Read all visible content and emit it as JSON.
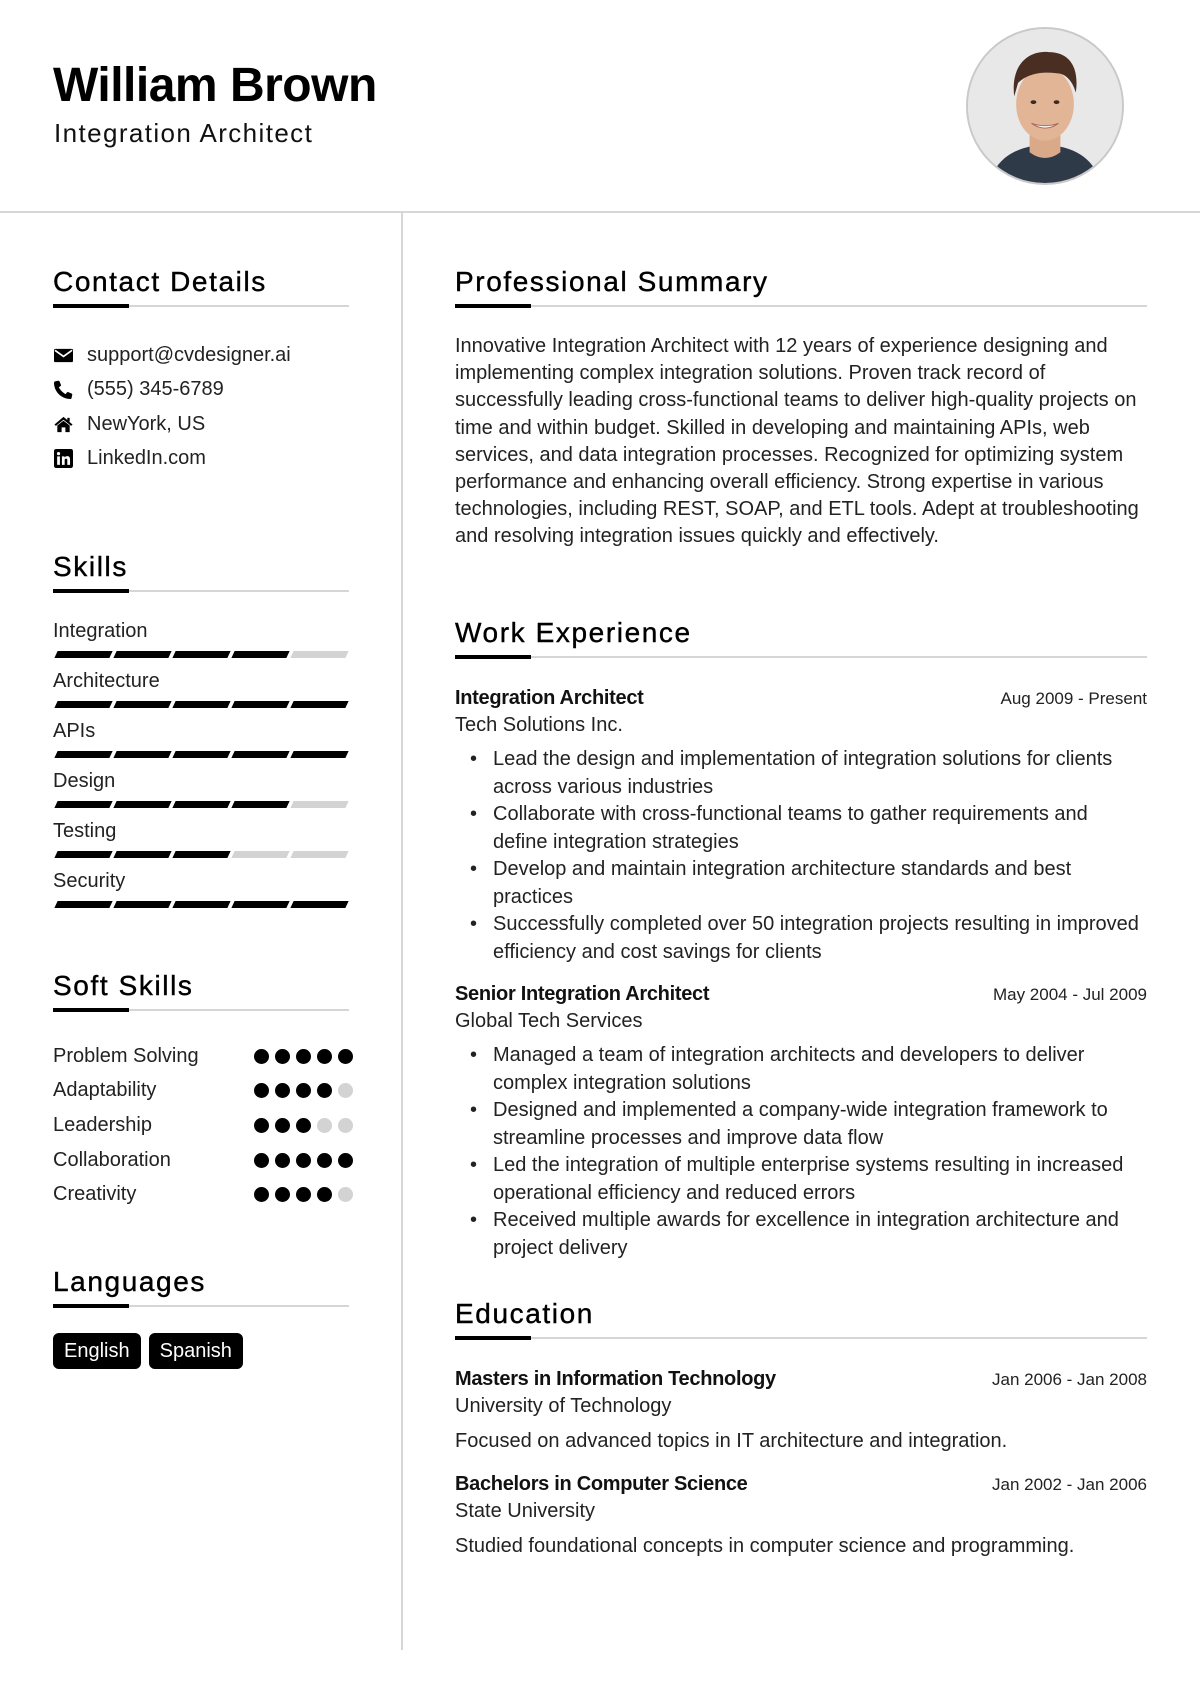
{
  "header": {
    "name": "William Brown",
    "title": "Integration Architect",
    "photo_alt": "profile-photo"
  },
  "contact": {
    "heading": "Contact Details",
    "items": [
      {
        "icon": "envelope-icon",
        "text": "support@cvdesigner.ai"
      },
      {
        "icon": "phone-icon",
        "text": "(555) 345-6789"
      },
      {
        "icon": "home-icon",
        "text": "NewYork, US"
      },
      {
        "icon": "linkedin-icon",
        "text": "LinkedIn.com"
      }
    ]
  },
  "skills": {
    "heading": "Skills",
    "max_level": 5,
    "items": [
      {
        "label": "Integration",
        "level": 4
      },
      {
        "label": "Architecture",
        "level": 5
      },
      {
        "label": "APIs",
        "level": 5
      },
      {
        "label": "Design",
        "level": 4
      },
      {
        "label": "Testing",
        "level": 3
      },
      {
        "label": "Security",
        "level": 5
      }
    ]
  },
  "soft_skills": {
    "heading": "Soft Skills",
    "max_level": 5,
    "items": [
      {
        "label": "Problem Solving",
        "level": 5
      },
      {
        "label": "Adaptability",
        "level": 4
      },
      {
        "label": "Leadership",
        "level": 3
      },
      {
        "label": "Collaboration",
        "level": 5
      },
      {
        "label": "Creativity",
        "level": 4
      }
    ]
  },
  "languages": {
    "heading": "Languages",
    "items": [
      "English",
      "Spanish"
    ]
  },
  "summary": {
    "heading": "Professional Summary",
    "text": "Innovative Integration Architect with 12 years of experience designing and implementing complex integration solutions. Proven track record of successfully leading cross-functional teams to deliver high-quality projects on time and within budget. Skilled in developing and maintaining APIs, web services, and data integration processes. Recognized for optimizing system performance and enhancing overall efficiency. Strong expertise in various technologies, including REST, SOAP, and ETL tools. Adept at troubleshooting and resolving integration issues quickly and effectively."
  },
  "experience": {
    "heading": "Work Experience",
    "jobs": [
      {
        "title": "Integration Architect",
        "dates": "Aug 2009 - Present",
        "company": "Tech Solutions Inc.",
        "bullets": [
          "Lead the design and implementation of integration solutions for clients across various industries",
          "Collaborate with cross-functional teams to gather requirements and define integration strategies",
          "Develop and maintain integration architecture standards and best practices",
          "Successfully completed over 50 integration projects resulting in improved efficiency and cost savings for clients"
        ]
      },
      {
        "title": "Senior Integration Architect",
        "dates": "May 2004 - Jul 2009",
        "company": "Global Tech Services",
        "bullets": [
          "Managed a team of integration architects and developers to deliver complex integration solutions",
          "Designed and implemented a company-wide integration framework to streamline processes and improve data flow",
          "Led the integration of multiple enterprise systems resulting in increased operational efficiency and reduced errors",
          "Received multiple awards for excellence in integration architecture and project delivery"
        ]
      }
    ]
  },
  "education": {
    "heading": "Education",
    "items": [
      {
        "degree": "Masters in Information Technology",
        "dates": "Jan 2006 - Jan 2008",
        "school": "University of Technology",
        "description": "Focused on advanced topics in IT architecture and integration."
      },
      {
        "degree": "Bachelors in Computer Science",
        "dates": "Jan 2002 - Jan 2006",
        "school": "State University",
        "description": "Studied foundational concepts in computer science and programming."
      }
    ]
  }
}
